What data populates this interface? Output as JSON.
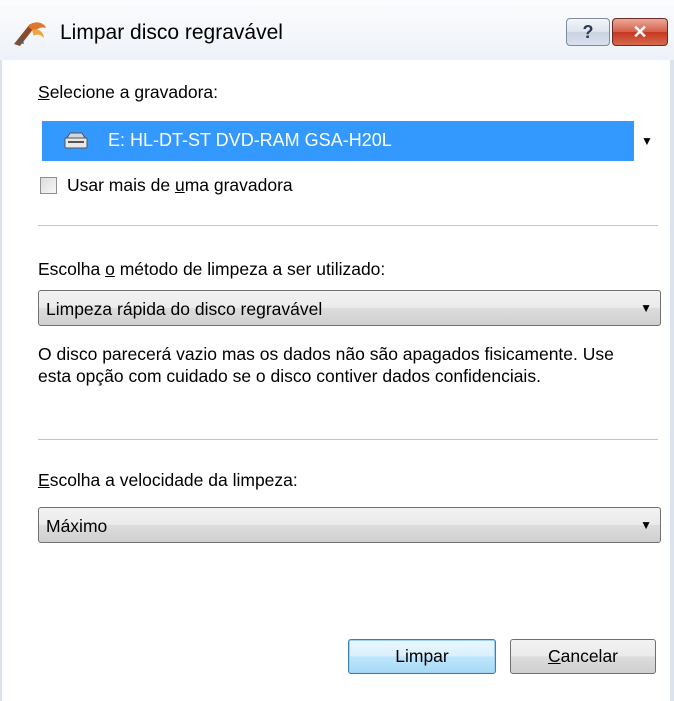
{
  "window": {
    "title": "Limpar disco regravável",
    "help_glyph": "?",
    "close_glyph": "✕",
    "app_icon": "nero-flame-icon"
  },
  "burner": {
    "label_accel": "S",
    "label_rest": "elecione a gravadora:",
    "selected": "E: HL-DT-ST DVD-RAM GSA-H20L",
    "icon": "drive-icon"
  },
  "multiple_burners": {
    "label_pre": "Usar mais de ",
    "label_accel": "u",
    "label_post": "ma gravadora",
    "checked": false
  },
  "method": {
    "label_pre": "Escolha ",
    "label_accel": "o",
    "label_post": " método de limpeza a ser utilizado:",
    "selected": "Limpeza rápida do disco regravável",
    "description": "O disco parecerá vazio mas os dados não são apagados fisicamente. Use esta opção com cuidado se o disco contiver dados confidenciais."
  },
  "speed": {
    "label_accel": "E",
    "label_rest": "scolha a velocidade da limpeza:",
    "selected": "Máximo"
  },
  "buttons": {
    "ok": "Limpar",
    "cancel_accel": "C",
    "cancel_rest": "ancelar"
  },
  "colors": {
    "selection": "#3399ff",
    "close_button": "#c4361f"
  }
}
